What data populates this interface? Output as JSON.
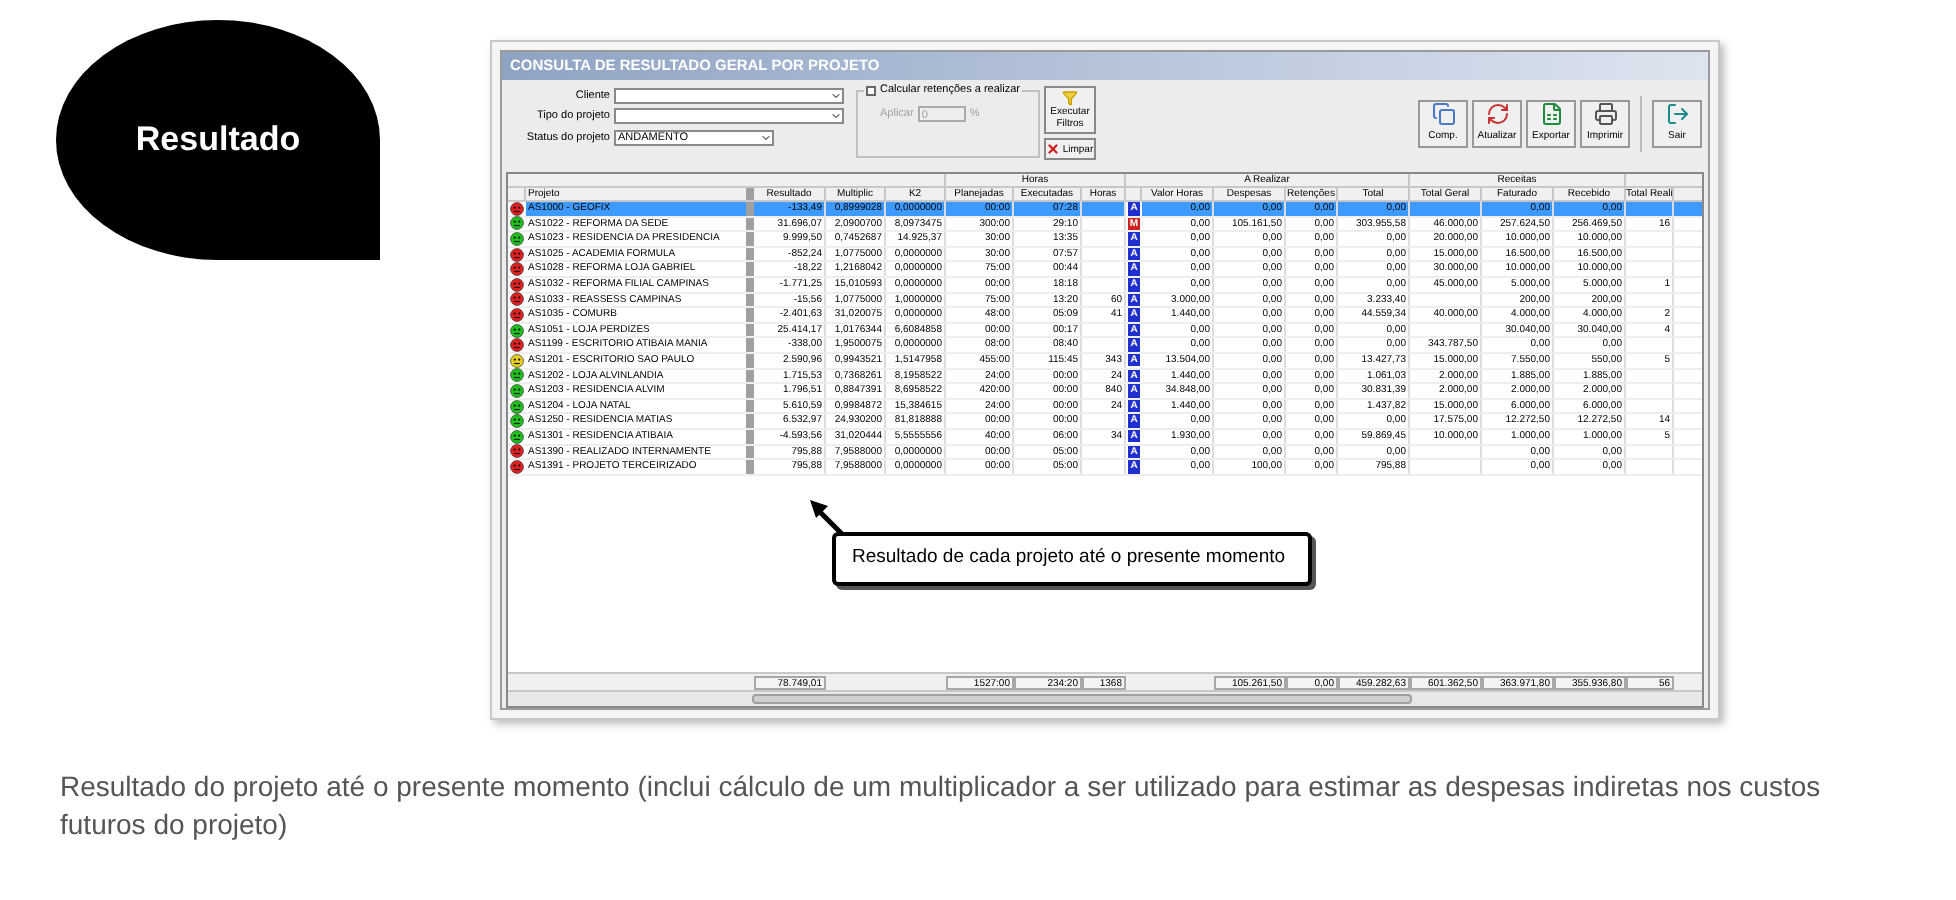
{
  "bubble": {
    "title": "Resultado"
  },
  "window": {
    "title": "CONSULTA DE RESULTADO GERAL POR PROJETO"
  },
  "filters": [
    {
      "label": "Cliente"
    },
    {
      "label": "Tipo do projeto"
    },
    {
      "label": "Status do projeto",
      "value": "ANDAMENTO"
    }
  ],
  "retention": {
    "label": "Calcular retenções a realizar",
    "checked": false,
    "apply_label": "Aplicar",
    "value": "0",
    "unit": "%",
    "disabled": true
  },
  "filter_buttons": [
    {
      "label": "Executar Filtros",
      "kind": "execute"
    },
    {
      "label": "Limpar",
      "kind": "clear"
    }
  ],
  "toolbar": [
    {
      "label": "Comp.",
      "kind": "document"
    },
    {
      "label": "Atualizar",
      "kind": "refresh"
    },
    {
      "label": "Exportar",
      "kind": "spreadsheet"
    },
    {
      "label": "Imprimir",
      "kind": "print"
    },
    {
      "label": "Sair",
      "kind": "exit"
    }
  ],
  "table": {
    "columns": [
      "Projeto",
      "Resultado",
      "Multiplic",
      "K2"
    ],
    "groups": [
      {
        "label": "Horas",
        "columns": [
          "Planejadas",
          "Executadas",
          "Horas"
        ]
      },
      {
        "label": "A Realizar",
        "columns": [
          "Valor Horas",
          "Despesas",
          "Retenções",
          "Total"
        ]
      },
      {
        "label": "Receitas",
        "columns": [
          "Total Geral",
          "Faturado",
          "Recebido"
        ]
      }
    ],
    "trailing_columns": [
      "Total Reali"
    ],
    "rows": [
      {
        "color": "#e02020",
        "selected": true,
        "flag": {
          "label": "A",
          "color": "#2030d0"
        },
        "cells": [
          "AS1000 - GEOFIX",
          "-133,49",
          "0,8999028",
          "0,0000000",
          "00:00",
          "07:28",
          "",
          "0,00",
          "0,00",
          "0,00",
          "0,00",
          "",
          "0,00",
          "0,00",
          ""
        ]
      },
      {
        "color": "#20c020",
        "selected": false,
        "flag": {
          "label": "M",
          "color": "#d02020"
        },
        "cells": [
          "AS1022 - REFORMA DA SEDE",
          "31.696,07",
          "2,0900700",
          "8,0973475",
          "300:00",
          "29:10",
          "",
          "0,00",
          "105.161,50",
          "0,00",
          "303.955,58",
          "46.000,00",
          "257.624,50",
          "256.469,50",
          "16"
        ]
      },
      {
        "color": "#20c020",
        "selected": false,
        "flag": {
          "label": "A",
          "color": "#2030d0"
        },
        "cells": [
          "AS1023 - RESIDENCIA DA PRESIDENCIA",
          "9.999,50",
          "0,7452687",
          "14.925,37",
          "30:00",
          "13:35",
          "",
          "0,00",
          "0,00",
          "0,00",
          "0,00",
          "20.000,00",
          "10.000,00",
          "10.000,00",
          ""
        ]
      },
      {
        "color": "#e02020",
        "selected": false,
        "flag": {
          "label": "A",
          "color": "#2030d0"
        },
        "cells": [
          "AS1025 - ACADEMIA FORMULA",
          "-852,24",
          "1,0775000",
          "0,0000000",
          "30:00",
          "07:57",
          "",
          "0,00",
          "0,00",
          "0,00",
          "0,00",
          "15.000,00",
          "16.500,00",
          "16.500,00",
          ""
        ]
      },
      {
        "color": "#e02020",
        "selected": false,
        "flag": {
          "label": "A",
          "color": "#2030d0"
        },
        "cells": [
          "AS1028 - REFORMA LOJA GABRIEL",
          "-18,22",
          "1,2168042",
          "0,0000000",
          "75:00",
          "00:44",
          "",
          "0,00",
          "0,00",
          "0,00",
          "0,00",
          "30.000,00",
          "10.000,00",
          "10.000,00",
          ""
        ]
      },
      {
        "color": "#e02020",
        "selected": false,
        "flag": {
          "label": "A",
          "color": "#2030d0"
        },
        "cells": [
          "AS1032 - REFORMA FILIAL CAMPINAS",
          "-1.771,25",
          "15,010593",
          "0,0000000",
          "00:00",
          "18:18",
          "",
          "0,00",
          "0,00",
          "0,00",
          "0,00",
          "45.000,00",
          "5.000,00",
          "5.000,00",
          "1"
        ]
      },
      {
        "color": "#e02020",
        "selected": false,
        "flag": {
          "label": "A",
          "color": "#2030d0"
        },
        "cells": [
          "AS1033 - REASSESS CAMPINAS",
          "-15,56",
          "1,0775000",
          "1,0000000",
          "75:00",
          "13:20",
          "60",
          "3.000,00",
          "0,00",
          "0,00",
          "3.233,40",
          "",
          "200,00",
          "200,00",
          ""
        ]
      },
      {
        "color": "#e02020",
        "selected": false,
        "flag": {
          "label": "A",
          "color": "#2030d0"
        },
        "cells": [
          "AS1035 - COMURB",
          "-2.401,63",
          "31,020075",
          "0,0000000",
          "48:00",
          "05:09",
          "41",
          "1.440,00",
          "0,00",
          "0,00",
          "44.559,34",
          "40.000,00",
          "4.000,00",
          "4.000,00",
          "2"
        ]
      },
      {
        "color": "#20c020",
        "selected": false,
        "flag": {
          "label": "A",
          "color": "#2030d0"
        },
        "cells": [
          "AS1051 - LOJA PERDIZES",
          "25.414,17",
          "1,0176344",
          "6,6084858",
          "00:00",
          "00:17",
          "",
          "0,00",
          "0,00",
          "0,00",
          "0,00",
          "",
          "30.040,00",
          "30.040,00",
          "4"
        ]
      },
      {
        "color": "#e02020",
        "selected": false,
        "flag": {
          "label": "A",
          "color": "#2030d0"
        },
        "cells": [
          "AS1199 - ESCRITORIO ATIBAIA MANIA",
          "-338,00",
          "1,9500075",
          "0,0000000",
          "08:00",
          "08:40",
          "",
          "0,00",
          "0,00",
          "0,00",
          "0,00",
          "343.787,50",
          "0,00",
          "0,00",
          ""
        ]
      },
      {
        "color": "#e8d020",
        "selected": false,
        "flag": {
          "label": "A",
          "color": "#2030d0"
        },
        "cells": [
          "AS1201 - ESCRITORIO SAO PAULO",
          "2.590,96",
          "0,9943521",
          "1,5147958",
          "455:00",
          "115:45",
          "343",
          "13.504,00",
          "0,00",
          "0,00",
          "13.427,73",
          "15.000,00",
          "7.550,00",
          "550,00",
          "5"
        ]
      },
      {
        "color": "#20c020",
        "selected": false,
        "flag": {
          "label": "A",
          "color": "#2030d0"
        },
        "cells": [
          "AS1202 - LOJA ALVINLANDIA",
          "1.715,53",
          "0,7368261",
          "8,1958522",
          "24:00",
          "00:00",
          "24",
          "1.440,00",
          "0,00",
          "0,00",
          "1.061,03",
          "2.000,00",
          "1.885,00",
          "1.885,00",
          ""
        ]
      },
      {
        "color": "#20c020",
        "selected": false,
        "flag": {
          "label": "A",
          "color": "#2030d0"
        },
        "cells": [
          "AS1203 - RESIDENCIA ALVIM",
          "1.796,51",
          "0,8847391",
          "8,6958522",
          "420:00",
          "00:00",
          "840",
          "34.848,00",
          "0,00",
          "0,00",
          "30.831,39",
          "2.000,00",
          "2.000,00",
          "2.000,00",
          ""
        ]
      },
      {
        "color": "#20c020",
        "selected": false,
        "flag": {
          "label": "A",
          "color": "#2030d0"
        },
        "cells": [
          "AS1204 - LOJA NATAL",
          "5.610,59",
          "0,9984872",
          "15,384615",
          "24:00",
          "00:00",
          "24",
          "1.440,00",
          "0,00",
          "0,00",
          "1.437,82",
          "15.000,00",
          "6.000,00",
          "6.000,00",
          ""
        ]
      },
      {
        "color": "#20c020",
        "selected": false,
        "flag": {
          "label": "A",
          "color": "#2030d0"
        },
        "cells": [
          "AS1250 - RESIDENCIA MATIAS",
          "6.532,97",
          "24,930200",
          "81,818888",
          "00:00",
          "00:00",
          "",
          "0,00",
          "0,00",
          "0,00",
          "0,00",
          "17.575,00",
          "12.272,50",
          "12.272,50",
          "14"
        ]
      },
      {
        "color": "#20c020",
        "selected": false,
        "flag": {
          "label": "A",
          "color": "#2030d0"
        },
        "cells": [
          "AS1301 - RESIDENCIA ATIBAIA",
          "-4.593,56",
          "31,020444",
          "5,5555556",
          "40:00",
          "06:00",
          "34",
          "1.930,00",
          "0,00",
          "0,00",
          "59.869,45",
          "10.000,00",
          "1.000,00",
          "1.000,00",
          "5"
        ]
      },
      {
        "color": "#e02020",
        "selected": false,
        "flag": {
          "label": "A",
          "color": "#2030d0"
        },
        "cells": [
          "AS1390 - REALIZADO INTERNAMENTE",
          "795,88",
          "7,9588000",
          "0,0000000",
          "00:00",
          "05:00",
          "",
          "0,00",
          "0,00",
          "0,00",
          "0,00",
          "",
          "0,00",
          "0,00",
          ""
        ]
      },
      {
        "color": "#e02020",
        "selected": false,
        "flag": {
          "label": "A",
          "color": "#2030d0"
        },
        "cells": [
          "AS1391 - PROJETO TERCEIRIZADO",
          "795,88",
          "7,9588000",
          "0,0000000",
          "00:00",
          "05:00",
          "",
          "0,00",
          "100,00",
          "0,00",
          "795,88",
          "",
          "0,00",
          "0,00",
          ""
        ]
      }
    ],
    "totals": {
      "resultado": "78.749,01",
      "planejadas": "1527:00",
      "executadas": "234:20",
      "horas": "1368",
      "despesas": "105.261,50",
      "retencoes": "0,00",
      "total": "459.282,63",
      "total_geral": "601.362,50",
      "faturado": "363.971,80",
      "recebido": "355.936,80",
      "total_reali": "56"
    }
  },
  "callout": {
    "text": "Resultado de cada projeto até o presente momento"
  },
  "caption": "Resultado do projeto até o presente momento (inclui cálculo de um multiplicador a ser utilizado para estimar as despesas indiretas nos custos futuros do projeto)"
}
